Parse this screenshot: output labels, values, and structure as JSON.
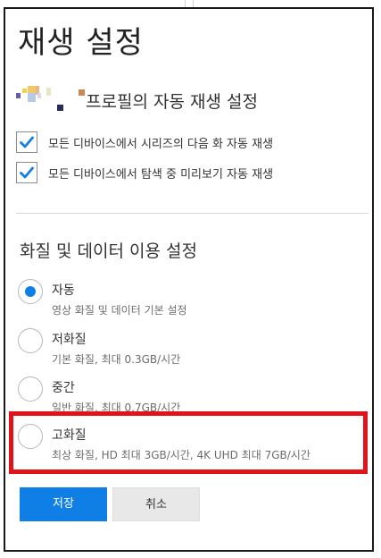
{
  "page": {
    "title": "재생 설정"
  },
  "profile": {
    "heading": "프로필의 자동 재생 설정"
  },
  "autoplay_options": [
    {
      "label": "모든 디바이스에서 시리즈의 다음 화 자동 재생",
      "checked": true
    },
    {
      "label": "모든 디바이스에서 탐색 중 미리보기 자동 재생",
      "checked": true
    }
  ],
  "quality_section": {
    "title": "화질 및 데이터 이용 설정"
  },
  "quality_options": [
    {
      "label": "자동",
      "description": "영상 화질 및 데이터 기본 설정",
      "selected": true
    },
    {
      "label": "저화질",
      "description": "기본 화질, 최대 0.3GB/시간",
      "selected": false
    },
    {
      "label": "중간",
      "description": "일반 화질, 최대 0.7GB/시간",
      "selected": false
    },
    {
      "label": "고화질",
      "description": "최상 화질, HD 최대 3GB/시간, 4K UHD 최대 7GB/시간",
      "selected": false
    }
  ],
  "buttons": {
    "save": "저장",
    "cancel": "취소"
  },
  "colors": {
    "accent": "#0f7fe6",
    "highlight": "#e0121a",
    "check": "#0f7fe6"
  }
}
